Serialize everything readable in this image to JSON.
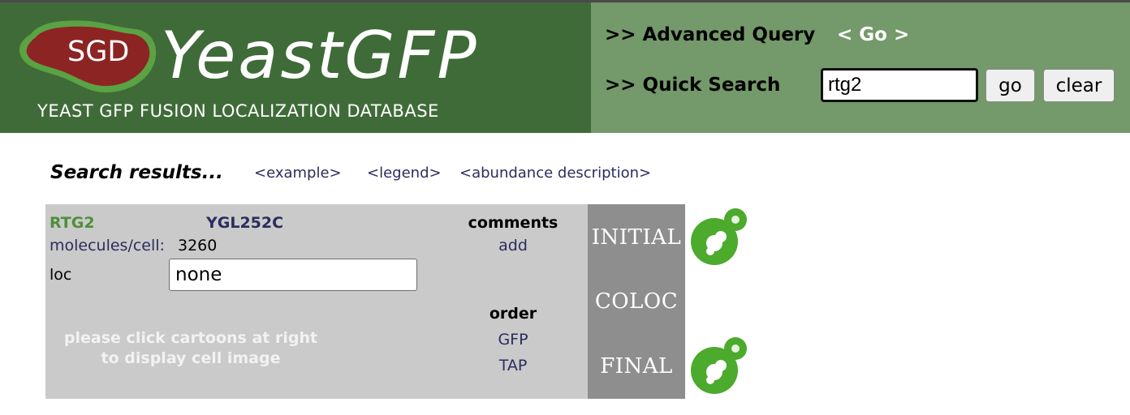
{
  "header": {
    "logo_text": "SGD",
    "app_title": "YeastGFP",
    "subtitle": "YEAST GFP FUSION LOCALIZATION DATABASE",
    "advanced_query_label": ">> Advanced Query",
    "advanced_query_go": "< Go >",
    "quick_search_label": ">> Quick Search",
    "quick_search_value": "rtg2",
    "go_button": "go",
    "clear_button": "clear"
  },
  "results": {
    "title": "Search results...",
    "links": [
      "<example>",
      "<legend>",
      "<abundance description>"
    ]
  },
  "gene": {
    "name": "RTG2",
    "orf": "YGL252C",
    "molecules_label": "molecules/cell:",
    "molecules_value": "3260",
    "loc_label": "loc",
    "loc_value": "none",
    "hint_lines": [
      "please click cartoons at right",
      "to display cell image"
    ]
  },
  "comments": {
    "header": "comments",
    "add_link": "add"
  },
  "order": {
    "header": "order",
    "links": [
      "GFP",
      "TAP"
    ]
  },
  "stages": [
    "INITIAL",
    "COLOC",
    "FINAL"
  ],
  "icons": {
    "cell_cartoon": "cell-cartoon-icon",
    "logo": "sgd-logo-icon"
  },
  "colors": {
    "header_dark": "#3f6b38",
    "header_light": "#74996a",
    "logo_red": "#8c2424",
    "logo_green": "#5aa243",
    "gene_green": "#4f8f3a",
    "link_navy": "#2c2c5e",
    "panel_gray": "#cacaca",
    "strip_gray": "#8e8e8e",
    "cell_green": "#4caa2c"
  }
}
